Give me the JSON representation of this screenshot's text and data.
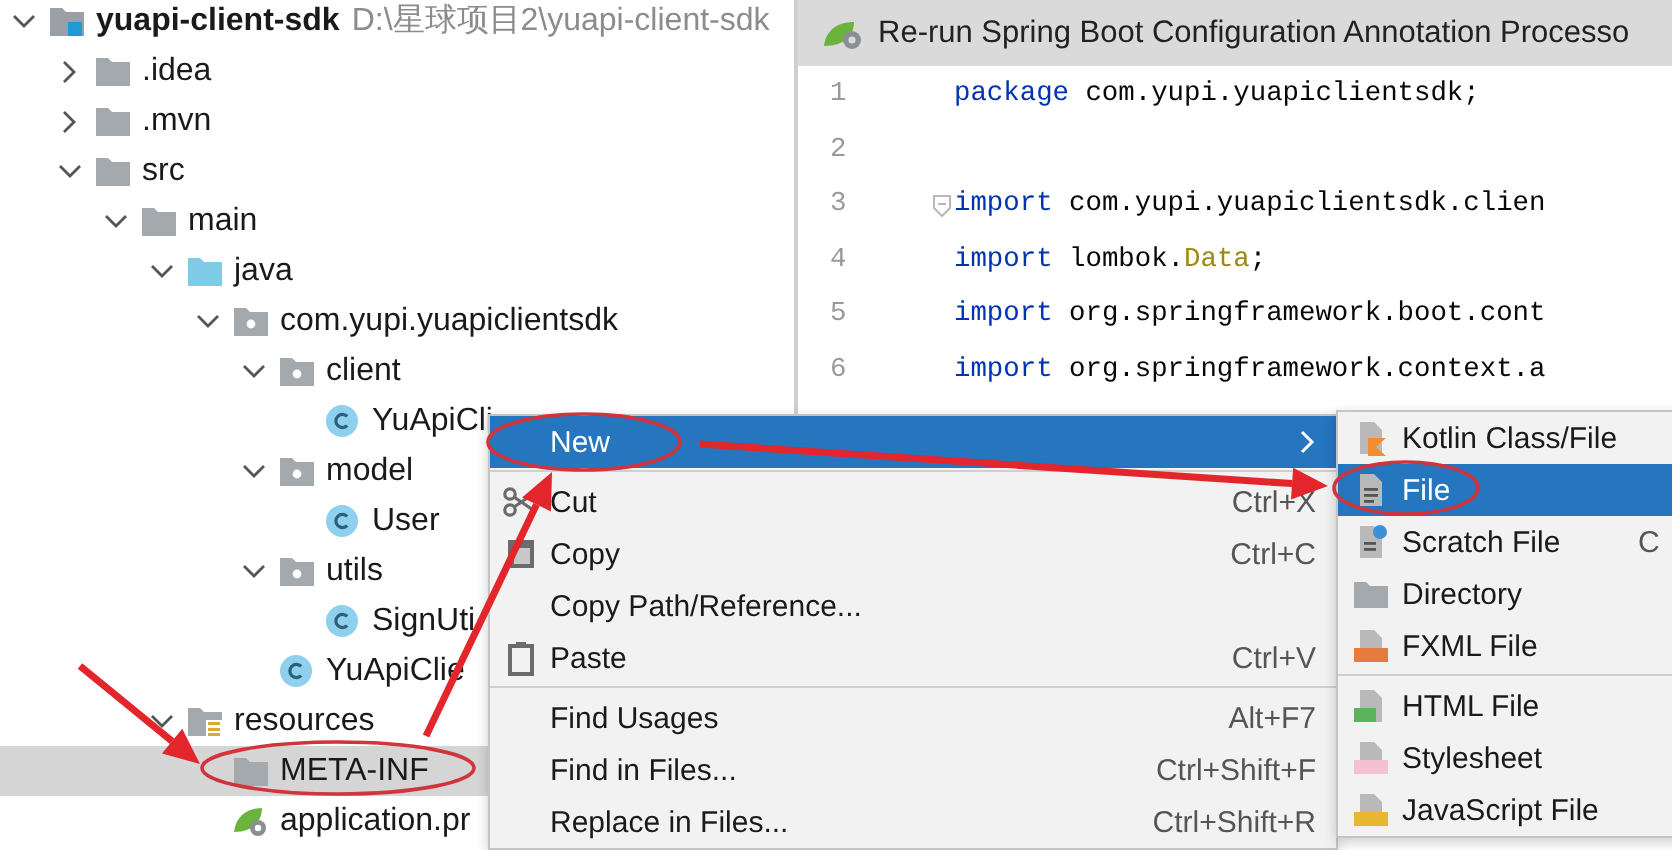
{
  "project_tree": {
    "items": [
      {
        "label": "yuapi-client-sdk",
        "path": "D:\\星球项目2\\yuapi-client-sdk",
        "kind": "module",
        "expanded": true,
        "selected": false,
        "children": [
          {
            "label": ".idea",
            "kind": "folder",
            "expanded": false,
            "selected": false
          },
          {
            "label": ".mvn",
            "kind": "folder",
            "expanded": false,
            "selected": false
          },
          {
            "label": "src",
            "kind": "folder",
            "expanded": true,
            "selected": false,
            "children": [
              {
                "label": "main",
                "kind": "folder",
                "expanded": true,
                "selected": false,
                "children": [
                  {
                    "label": "java",
                    "kind": "source",
                    "expanded": true,
                    "selected": false,
                    "children": [
                      {
                        "label": "com.yupi.yuapiclientsdk",
                        "kind": "package",
                        "expanded": true,
                        "selected": false,
                        "children": [
                          {
                            "label": "client",
                            "kind": "package",
                            "expanded": true,
                            "selected": false,
                            "children": [
                              {
                                "label": "YuApiCli",
                                "kind": "class",
                                "selected": false
                              }
                            ]
                          },
                          {
                            "label": "model",
                            "kind": "package",
                            "expanded": true,
                            "selected": false,
                            "children": [
                              {
                                "label": "User",
                                "kind": "class",
                                "selected": false
                              }
                            ]
                          },
                          {
                            "label": "utils",
                            "kind": "package",
                            "expanded": true,
                            "selected": false,
                            "children": [
                              {
                                "label": "SignUti",
                                "kind": "class",
                                "selected": false
                              }
                            ]
                          },
                          {
                            "label": "YuApiClie",
                            "kind": "class",
                            "selected": false
                          }
                        ]
                      }
                    ]
                  },
                  {
                    "label": "resources",
                    "kind": "resources",
                    "expanded": true,
                    "selected": false,
                    "children": [
                      {
                        "label": "META-INF",
                        "kind": "folder",
                        "selected": true
                      },
                      {
                        "label": "application.pr",
                        "kind": "config",
                        "selected": false
                      }
                    ]
                  }
                ]
              }
            ]
          }
        ]
      }
    ]
  },
  "editor": {
    "banner": "Re-run Spring Boot Configuration Annotation Processo",
    "lines": [
      {
        "number": "1",
        "tokens": [
          {
            "text": "package",
            "kind": "keyword"
          },
          {
            "text": " com.yupi.yuapiclientsdk;",
            "kind": "plain"
          }
        ]
      },
      {
        "number": "2"
      },
      {
        "number": "3",
        "foldable": true,
        "tokens": [
          {
            "text": "import",
            "kind": "keyword"
          },
          {
            "text": " com.yupi.yuapiclientsdk.clien",
            "kind": "plain"
          }
        ]
      },
      {
        "number": "4",
        "tokens": [
          {
            "text": "import",
            "kind": "keyword"
          },
          {
            "text": " lombok.",
            "kind": "plain"
          },
          {
            "text": "Data",
            "kind": "annotation"
          },
          {
            "text": ";",
            "kind": "plain"
          }
        ]
      },
      {
        "number": "5",
        "tokens": [
          {
            "text": "import",
            "kind": "keyword"
          },
          {
            "text": " org.springframework.boot.cont",
            "kind": "plain"
          }
        ]
      },
      {
        "number": "6",
        "tokens": [
          {
            "text": "import",
            "kind": "keyword"
          },
          {
            "text": " org.springframework.context.a",
            "kind": "plain"
          }
        ]
      }
    ]
  },
  "context_menu": {
    "items": [
      {
        "kind": "submenu",
        "label": "New",
        "selected": true
      },
      {
        "kind": "separator"
      },
      {
        "kind": "cut",
        "label": "Cut",
        "shortcut": "Ctrl+X",
        "selected": false
      },
      {
        "kind": "copy",
        "label": "Copy",
        "shortcut": "Ctrl+C",
        "selected": false
      },
      {
        "kind": "plain",
        "label": "Copy Path/Reference...",
        "selected": false
      },
      {
        "kind": "paste",
        "label": "Paste",
        "shortcut": "Ctrl+V",
        "selected": false
      },
      {
        "kind": "separator"
      },
      {
        "kind": "plain",
        "label": "Find Usages",
        "shortcut": "Alt+F7",
        "selected": false
      },
      {
        "kind": "plain",
        "label": "Find in Files...",
        "shortcut": "Ctrl+Shift+F",
        "selected": false
      },
      {
        "kind": "plain",
        "label": "Replace in Files...",
        "shortcut": "Ctrl+Shift+R",
        "selected": false
      }
    ]
  },
  "new_submenu": {
    "items": [
      {
        "kind": "kotlin",
        "label": "Kotlin Class/File",
        "selected": false
      },
      {
        "kind": "file",
        "label": "File",
        "selected": true
      },
      {
        "kind": "scratch",
        "label": "Scratch File",
        "shortcut": "C",
        "selected": false
      },
      {
        "kind": "directory",
        "label": "Directory",
        "selected": false
      },
      {
        "kind": "fxml",
        "label": "FXML File",
        "selected": false
      },
      {
        "kind": "separator"
      },
      {
        "kind": "html",
        "label": "HTML File",
        "selected": false
      },
      {
        "kind": "css",
        "label": "Stylesheet",
        "selected": false
      },
      {
        "kind": "js",
        "label": "JavaScript File",
        "selected": false
      }
    ]
  }
}
